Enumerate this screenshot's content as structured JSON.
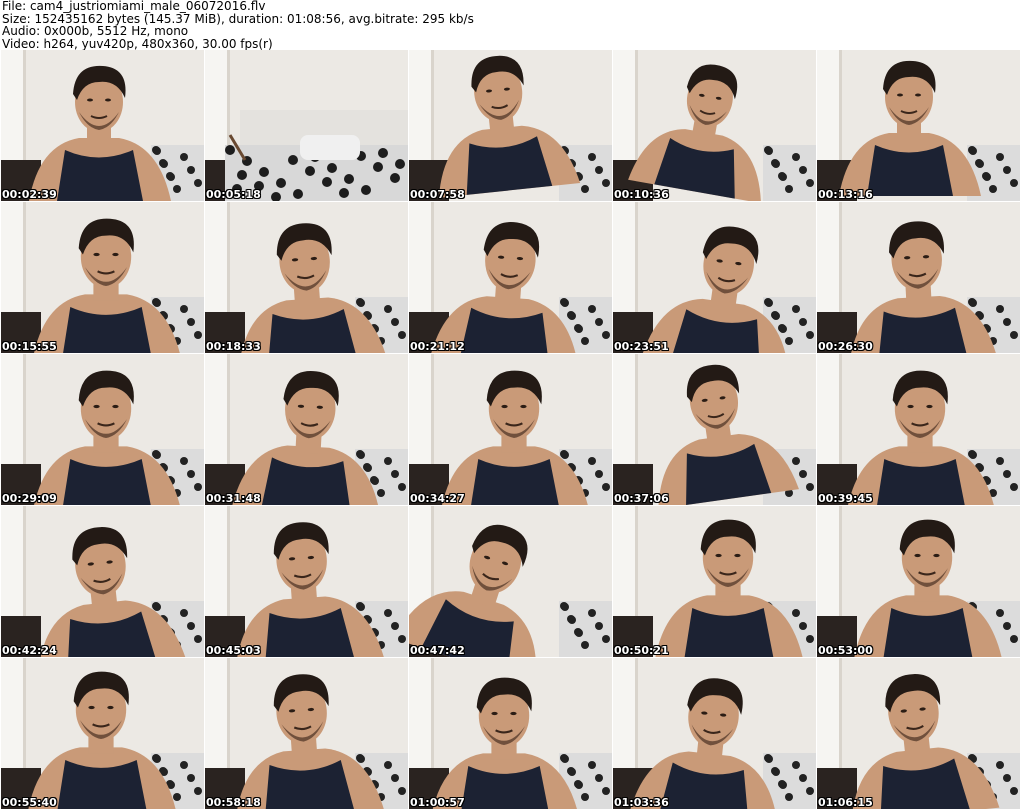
{
  "header": {
    "file": "File: cam4_justriomiami_male_06072016.flv",
    "size": "Size: 152435162 bytes (145.37 MiB), duration: 01:08:56, avg.bitrate: 295 kb/s",
    "audio": "Audio: 0x000b, 5512 Hz, mono",
    "video": "Video: h264, yuv420p, 480x360, 30.00 fps(r)"
  },
  "thumbnails": [
    {
      "time": "00:02:39"
    },
    {
      "time": "00:05:18"
    },
    {
      "time": "00:07:58"
    },
    {
      "time": "00:10:36"
    },
    {
      "time": "00:13:16"
    },
    {
      "time": "00:15:55"
    },
    {
      "time": "00:18:33"
    },
    {
      "time": "00:21:12"
    },
    {
      "time": "00:23:51"
    },
    {
      "time": "00:26:30"
    },
    {
      "time": "00:29:09"
    },
    {
      "time": "00:31:48"
    },
    {
      "time": "00:34:27"
    },
    {
      "time": "00:37:06"
    },
    {
      "time": "00:39:45"
    },
    {
      "time": "00:42:24"
    },
    {
      "time": "00:45:03"
    },
    {
      "time": "00:47:42"
    },
    {
      "time": "00:50:21"
    },
    {
      "time": "00:53:00"
    },
    {
      "time": "00:55:40"
    },
    {
      "time": "00:58:18"
    },
    {
      "time": "01:00:57"
    },
    {
      "time": "01:03:36"
    },
    {
      "time": "01:06:15"
    }
  ],
  "colors": {
    "wall": "#ece9e4",
    "shirt": "#1c2233",
    "skin": "#c99a78",
    "hair": "#231a15"
  }
}
